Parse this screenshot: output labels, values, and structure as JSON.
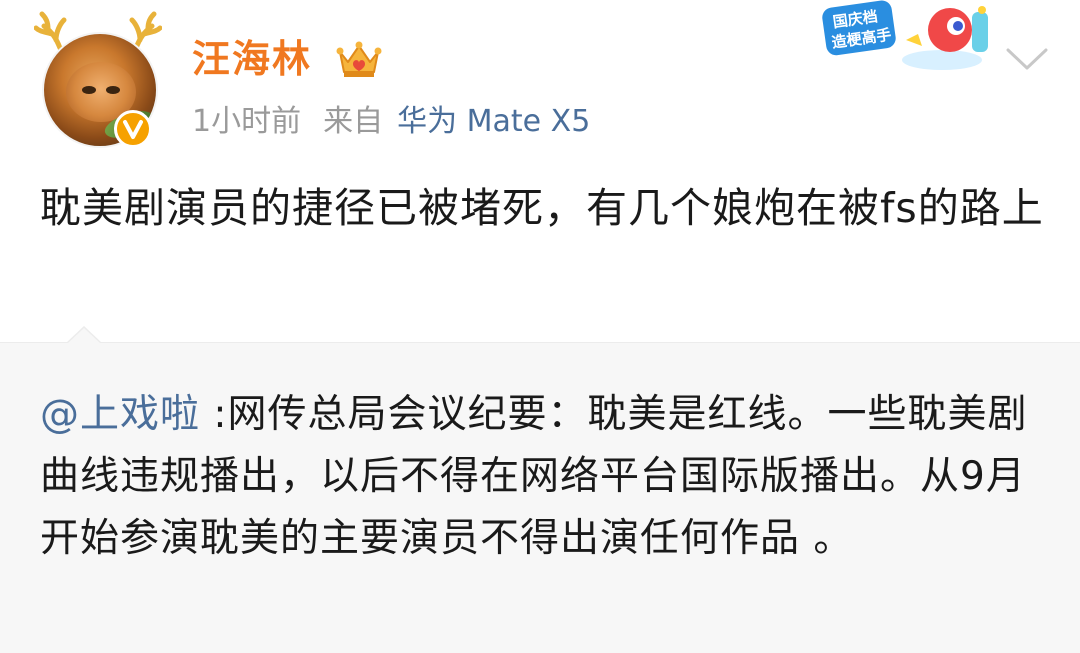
{
  "author": {
    "name": "汪海林",
    "timestamp": "1小时前",
    "source_prefix": "来自",
    "device": "华为 Mate X5"
  },
  "promo_badge": {
    "line1": "国庆档",
    "line2": "造梗高手"
  },
  "post": {
    "text": "耽美剧演员的捷径已被堵死，有几个娘炮在被fs的路上"
  },
  "retweet": {
    "mention": "@上戏啦",
    "text": " :网传总局会议纪要：耽美是红线。一些耽美剧曲线违规播出，以后不得在网络平台国际版播出。从9月开始参演耽美的主要演员不得出演任何作品 。"
  },
  "icons": [
    "antler-icon",
    "avatar",
    "verified-v-icon",
    "crown-icon",
    "promo-mascot-icon",
    "chevron-down-icon"
  ],
  "colors": {
    "username": "#f07820",
    "device_link": "#4a6e9a",
    "mention": "#4a6e9a",
    "meta": "#9a9a9a",
    "retweet_bg": "#f7f7f7",
    "verified": "#f6a100"
  }
}
